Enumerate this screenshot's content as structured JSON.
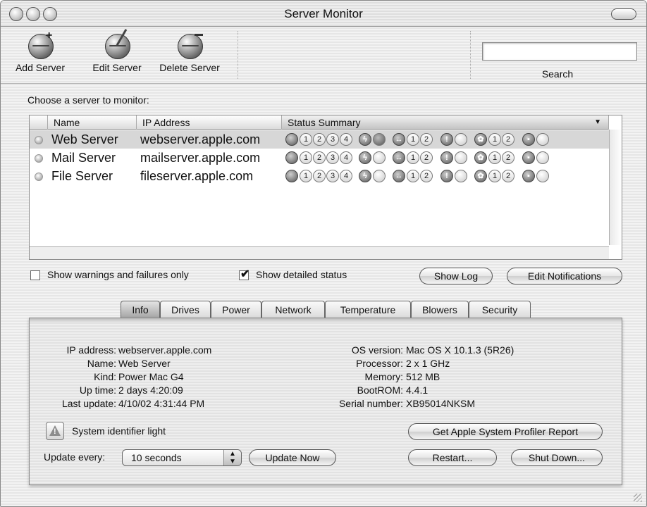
{
  "window": {
    "title": "Server Monitor"
  },
  "toolbar": {
    "add_label": "Add Server",
    "edit_label": "Edit Server",
    "delete_label": "Delete Server",
    "search_label": "Search",
    "search_value": ""
  },
  "servers": {
    "prompt": "Choose a server to monitor:",
    "columns": {
      "name": "Name",
      "ip": "IP Address",
      "status": "Status Summary"
    },
    "rows": [
      {
        "name": "Web Server",
        "ip": "webserver.apple.com",
        "selected": true
      },
      {
        "name": "Mail Server",
        "ip": "mailserver.apple.com",
        "selected": false
      },
      {
        "name": "File Server",
        "ip": "fileserver.apple.com",
        "selected": false
      }
    ],
    "status_icons": {
      "drive_numbers": [
        "1",
        "2",
        "3",
        "4"
      ],
      "network_numbers": [
        "1",
        "2"
      ],
      "blower_numbers": [
        "1",
        "2"
      ]
    }
  },
  "options": {
    "warnings_only_label": "Show warnings and failures only",
    "warnings_only_checked": false,
    "detailed_label": "Show detailed status",
    "detailed_checked": true,
    "show_log": "Show Log",
    "edit_notifications": "Edit Notifications"
  },
  "tabs": [
    "Info",
    "Drives",
    "Power",
    "Network",
    "Temperature",
    "Blowers",
    "Security"
  ],
  "active_tab": "Info",
  "info": {
    "left": [
      {
        "label": "IP address:",
        "value": "webserver.apple.com"
      },
      {
        "label": "Name:",
        "value": "Web Server"
      },
      {
        "label": "Kind:",
        "value": "Power Mac G4"
      },
      {
        "label": "Up time:",
        "value": "2 days 4:20:09"
      },
      {
        "label": "Last update:",
        "value": "4/10/02 4:31:44 PM"
      }
    ],
    "right": [
      {
        "label": "OS version:",
        "value": "Mac OS X 10.1.3 (5R26)"
      },
      {
        "label": "Processor:",
        "value": "2 x 1 GHz"
      },
      {
        "label": "Memory:",
        "value": "512 MB"
      },
      {
        "label": "BootROM:",
        "value": "4.4.1"
      },
      {
        "label": "Serial number:",
        "value": "XB95014NKSM"
      }
    ],
    "identifier_light_label": "System identifier light",
    "profiler_button": "Get Apple System Profiler Report",
    "update_every_label": "Update every:",
    "update_every_value": "10 seconds",
    "update_now": "Update Now",
    "restart": "Restart...",
    "shut_down": "Shut Down..."
  }
}
